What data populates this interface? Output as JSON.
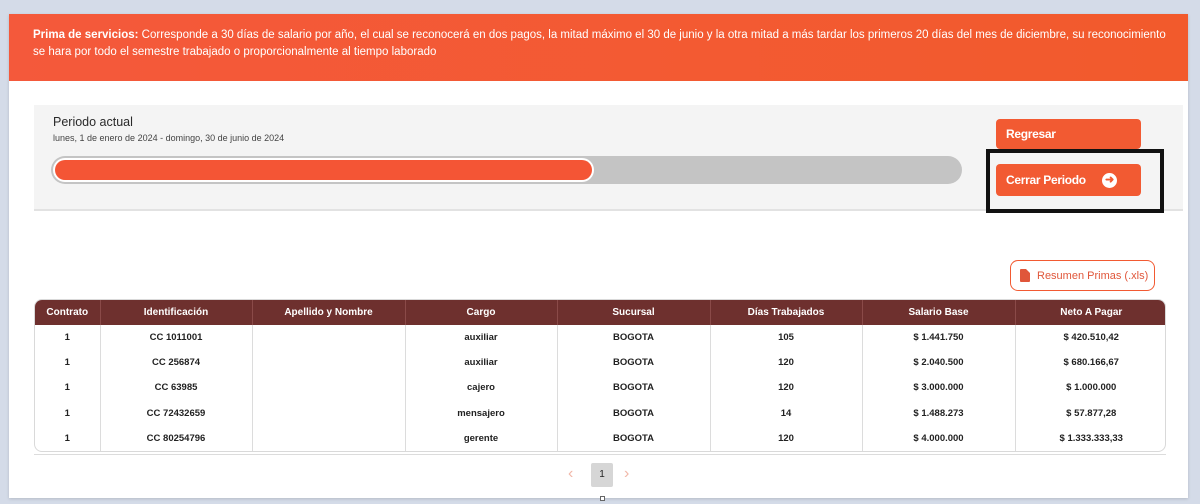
{
  "banner": {
    "label": "Prima de servicios:",
    "text": " Corresponde a 30 días de salario por año, el cual se reconocerá en dos pagos, la mitad máximo el 30 de junio y la otra mitad a más tardar los primeros 20 días del mes de diciembre, su reconocimiento se hara por todo el semestre trabajado o proporcionalmente al tiempo laborado"
  },
  "period": {
    "title": "Periodo actual",
    "range": "lunes, 1 de enero de 2024 - domingo, 30 de junio de 2024",
    "progress_percent": 59.5
  },
  "buttons": {
    "regresar": "Regresar",
    "cerrar_periodo": "Cerrar Periodo",
    "cerrar_icon": "arrow-right-circle-icon",
    "resumen": "Resumen Primas (.xls)",
    "resumen_icon": "pdf-file-icon"
  },
  "colors": {
    "accent": "#f25a32",
    "table_header": "#6e302e",
    "highlight_border": "#111111"
  },
  "table": {
    "columns": [
      "Contrato",
      "Identificación",
      "Apellido y Nombre",
      "Cargo",
      "Sucursal",
      "Días Trabajados",
      "Salario Base",
      "Neto A Pagar"
    ],
    "rows": [
      [
        "1",
        "CC 1011001",
        "",
        "auxiliar",
        "BOGOTA",
        "105",
        "$ 1.441.750",
        "$ 420.510,42"
      ],
      [
        "1",
        "CC 256874",
        "",
        "auxiliar",
        "BOGOTA",
        "120",
        "$ 2.040.500",
        "$ 680.166,67"
      ],
      [
        "1",
        "CC 63985",
        "",
        "cajero",
        "BOGOTA",
        "120",
        "$ 3.000.000",
        "$ 1.000.000"
      ],
      [
        "1",
        "CC 72432659",
        "",
        "mensajero",
        "BOGOTA",
        "14",
        "$ 1.488.273",
        "$ 57.877,28"
      ],
      [
        "1",
        "CC 80254796",
        "",
        "gerente",
        "BOGOTA",
        "120",
        "$ 4.000.000",
        "$ 1.333.333,33"
      ]
    ]
  },
  "pagination": {
    "current_page": "1",
    "prev_icon": "chevron-left-icon",
    "next_icon": "chevron-right-icon"
  }
}
